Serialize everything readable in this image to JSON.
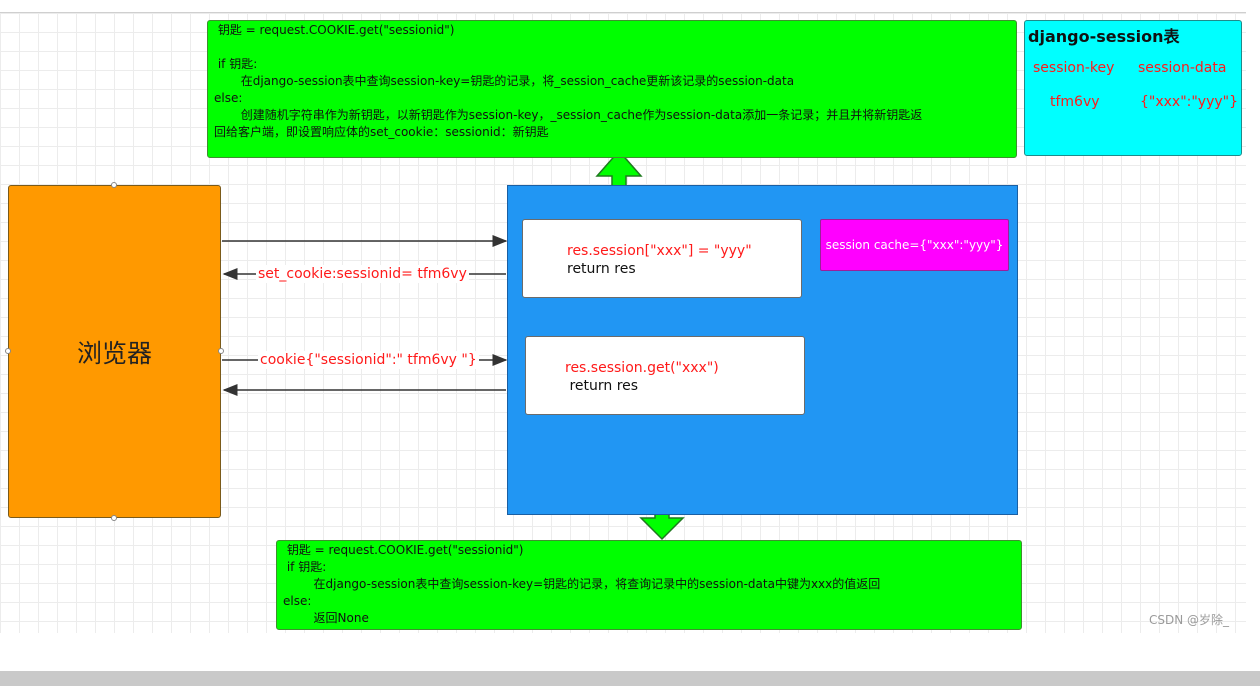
{
  "browser": {
    "label": "浏览器"
  },
  "top_logic": {
    "lines": [
      " 钥匙 = request.COOKIE.get(\"sessionid\")",
      "",
      " if 钥匙:",
      "       在django-session表中查询session-key=钥匙的记录，将_session_cache更新该记录的session-data",
      "else:",
      "       创建随机字符串作为新钥匙，以新钥匙作为session-key，_session_cache作为session-data添加一条记录；并且并将新钥匙返",
      "回给客户端，即设置响应体的set_cookie：sessionid：新钥匙"
    ]
  },
  "bottom_logic": {
    "lines": [
      " 钥匙 = request.COOKIE.get(\"sessionid\")",
      " if 钥匙:",
      "        在django-session表中查询session-key=钥匙的记录，将查询记录中的session-data中键为xxx的值返回",
      "else:",
      "        返回None"
    ]
  },
  "session_table": {
    "title": "django-session表",
    "headers": [
      "session-key",
      "session-data"
    ],
    "row": [
      "tfm6vy",
      "{\"xxx\":\"yyy\"}"
    ]
  },
  "set_box": {
    "code": "res.session[\"xxx\"] = \"yyy\"",
    "ret": "return res"
  },
  "get_box": {
    "code": "res.session.get(\"xxx\")",
    "ret": " return res"
  },
  "cache": {
    "label": "session cache={\"xxx\":\"yyy\"}"
  },
  "connections": {
    "set_cookie": "set_cookie:sessionid= tfm6vy",
    "cookie": "cookie{\"sessionid\":\" tfm6vy \"}"
  },
  "watermark": "CSDN @岁除_",
  "colors": {
    "browser": "#ff9900",
    "server": "#2196f3",
    "logic": "#00ff00",
    "cache": "#ff00ff",
    "table": "#00ffff",
    "highlight_text": "#ff1a1a"
  }
}
